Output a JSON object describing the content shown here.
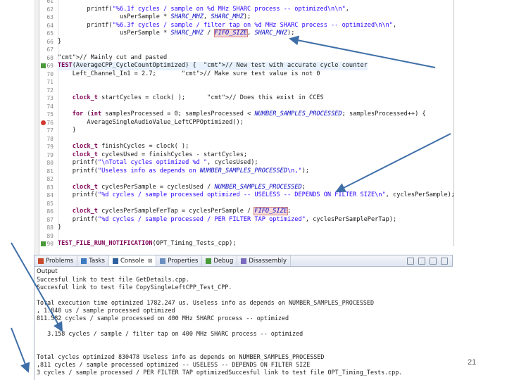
{
  "editor": {
    "lines": [
      {
        "n": "61",
        "t": ""
      },
      {
        "n": "62",
        "t": "        printf(\"%6.1f cycles / sample on %d MHz SHARC process -- optimized\\n\\n\","
      },
      {
        "n": "63",
        "t": "                 usPerSample * SHARC_MHZ, SHARC_MHZ);"
      },
      {
        "n": "64",
        "t": "        printf(\"%6.3f cycles / sample / filter tap on %d MHz SHARC process -- optimized\\n\\n\","
      },
      {
        "n": "65",
        "t": "                 usPerSample * SHARC_MHZ / FIFO_SIZE, SHARC_MHZ);"
      },
      {
        "n": "66",
        "t": "}"
      },
      {
        "n": "67",
        "t": ""
      },
      {
        "n": "68",
        "t": "// Mainly cut and pasted"
      },
      {
        "n": "69",
        "t": "TEST(AverageCPP_CycleCountOptimized) {  // New test with accurate cycle counter"
      },
      {
        "n": "70",
        "t": "    Left_Channel_In1 = 2.7;       // Make sure test value is not 0"
      },
      {
        "n": "71",
        "t": ""
      },
      {
        "n": "72",
        "t": ""
      },
      {
        "n": "73",
        "t": "    clock_t startCycles = clock( );      // Does this exist in CCES"
      },
      {
        "n": "74",
        "t": ""
      },
      {
        "n": "75",
        "t": "    for (int samplesProcessed = 0; samplesProcessed < NUMBER_SAMPLES_PROCESSED; samplesProcessed++) {"
      },
      {
        "n": "76",
        "t": "        AverageSingleAudioValue_LeftCPPOptimized();"
      },
      {
        "n": "77",
        "t": "    }"
      },
      {
        "n": "78",
        "t": ""
      },
      {
        "n": "79",
        "t": "    clock_t finishCycles = clock( );"
      },
      {
        "n": "79",
        "t": "    clock_t cyclesUsed = finishCycles - startCycles;"
      },
      {
        "n": "80",
        "t": "    printf(\"\\nTotal cycles optimized %d \", cyclesUsed);"
      },
      {
        "n": "81",
        "t": "    printf(\"Useless info as depends on NUMBER_SAMPLES_PROCESSED\\n,\");"
      },
      {
        "n": "82",
        "t": ""
      },
      {
        "n": "83",
        "t": "    clock_t cyclesPerSample = cyclesUsed / NUMBER_SAMPLES_PROCESSED;"
      },
      {
        "n": "84",
        "t": "    printf(\"%d cycles / sample processed optimized -- USELESS -- DEPENDS ON FILTER SIZE\\n\", cyclesPerSample);"
      },
      {
        "n": "85",
        "t": ""
      },
      {
        "n": "86",
        "t": "    clock_t cyclesPerSampleFerTap = cyclesPerSample / FIFO_SIZE;"
      },
      {
        "n": "87",
        "t": "    printf(\"%d cycles / sample processed / PER FILTER TAP optimized\", cyclesPerSamplePerTap);"
      },
      {
        "n": "88",
        "t": "}"
      },
      {
        "n": "89",
        "t": ""
      },
      {
        "n": "90",
        "t": "TEST_FILE_RUN_NOTIFICATION(OPT_Timing_Tests_cpp);"
      },
      {
        "n": "91",
        "t": ""
      }
    ]
  },
  "tabs": [
    {
      "label": "Problems",
      "icon": "problems-icon",
      "color": "#c94a2a"
    },
    {
      "label": "Tasks",
      "icon": "tasks-icon",
      "color": "#3a7abf"
    },
    {
      "label": "Console",
      "icon": "console-icon",
      "color": "#2f5f9f",
      "close": "⊠"
    },
    {
      "label": "Properties",
      "icon": "properties-icon",
      "color": "#6a8fbf"
    },
    {
      "label": "Debug",
      "icon": "debug-icon",
      "color": "#4a9a3a"
    },
    {
      "label": "Disassembly",
      "icon": "disassembly-icon",
      "color": "#7a6abf"
    }
  ],
  "console": {
    "title": "Output",
    "lines": [
      "Succesful link to test file GetDetails.cpp.",
      "Succesful link to test file CopySingleLeftCPP_Test_CPP.",
      "",
      "Total execution time optimized 1782.247 us. Useless info as depends on NUMBER_SAMPLES_PROCESSED",
      ", 1.840 us / sample processed optimized",
      "811.582 cycles / sample processed on 400 MHz SHARC process -- optimized",
      "",
      "   3.158 cycles / sample / filter tap on 400 MHz SHARC process -- optimized",
      "",
      "",
      "Total cycles optimized 830478 Useless info as depends on NUMBER_SAMPLES_PROCESSED",
      ",811 cycles / sample processed optimized -- USELESS -- DEPENDS ON FILTER SIZE",
      "3 cycles / sample processed / PER FILTER TAP optimizedSuccesful link to test file OPT_Timing_Tests.cpp."
    ]
  },
  "slide": {
    "page_number": "21"
  },
  "colors": {
    "arrow": "#3f6fa8"
  }
}
